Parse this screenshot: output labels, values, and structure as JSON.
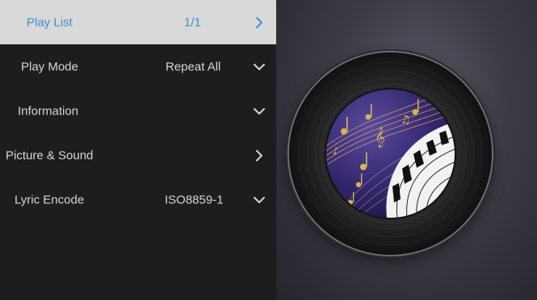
{
  "menu": {
    "items": [
      {
        "label": "Play List",
        "value": "1/1",
        "chevron": "chevron-right-icon"
      },
      {
        "label": "Play Mode",
        "value": "Repeat All",
        "chevron": "chevron-down-icon"
      },
      {
        "label": "Information",
        "value": "",
        "chevron": "chevron-down-icon"
      },
      {
        "label": "Picture & Sound",
        "value": "",
        "chevron": "chevron-right-icon"
      },
      {
        "label": "Lyric Encode",
        "value": "ISO8859-1",
        "chevron": "chevron-down-icon"
      }
    ]
  },
  "colors": {
    "accent": "#3e8fcf",
    "active_row": "#d9d9d9",
    "menu_bg": "#1d1d20",
    "text": "#d6d6d6",
    "music_note": "#d8b25a",
    "album_bg": "#3b2c6b"
  },
  "album_art": {
    "icon": "vinyl-record-icon",
    "cover_icon": "piano-music-notes-icon"
  }
}
